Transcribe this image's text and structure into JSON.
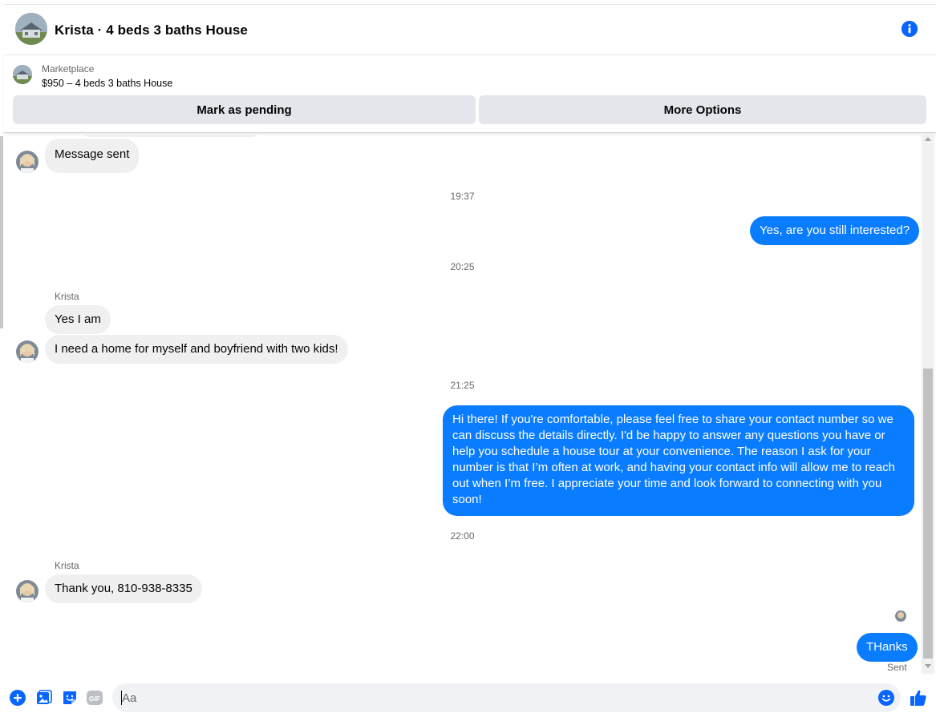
{
  "header": {
    "title": "Krista · 4 beds 3 baths House"
  },
  "marketplace": {
    "label": "Marketplace",
    "item": "$950 – 4 beds 3 baths House",
    "pending_label": "Mark as pending",
    "more_label": "More Options"
  },
  "messages": {
    "msg_sent": "Message sent",
    "ts1": "19:37",
    "out1": "Yes, are you still interested?",
    "ts2": "20:25",
    "sender1": "Krista",
    "in1": "Yes I am",
    "in2": "I need a home for myself and boyfriend with two kids!",
    "ts3": "21:25",
    "out2": "Hi there! If you're comfortable, please feel free to share your contact number so we can discuss the details directly. I'd be happy to answer any questions you have or help you schedule a house tour at your convenience. The reason I ask for your number is that I’m often at work, and having your contact info will allow me to reach out when I’m free. I appreciate your time and look forward to connecting with you soon!",
    "ts4": "22:00",
    "sender2": "Krista",
    "in3": "Thank you, 810-938-8335",
    "out3": "THanks",
    "status": "Sent"
  },
  "composer": {
    "placeholder": "Aa"
  },
  "icons": {
    "info": "info-icon",
    "plus": "plus-circle-icon",
    "gallery": "photo-gallery-icon",
    "sticker": "sticker-icon",
    "gif": "gif-icon",
    "emoji": "emoji-icon",
    "like": "thumbs-up-icon"
  },
  "colors": {
    "accent": "#0866ff",
    "outgoing_bubble": "#0a7cff",
    "incoming_bubble": "#f0f0f0",
    "button_bg": "#e4e6eb"
  }
}
